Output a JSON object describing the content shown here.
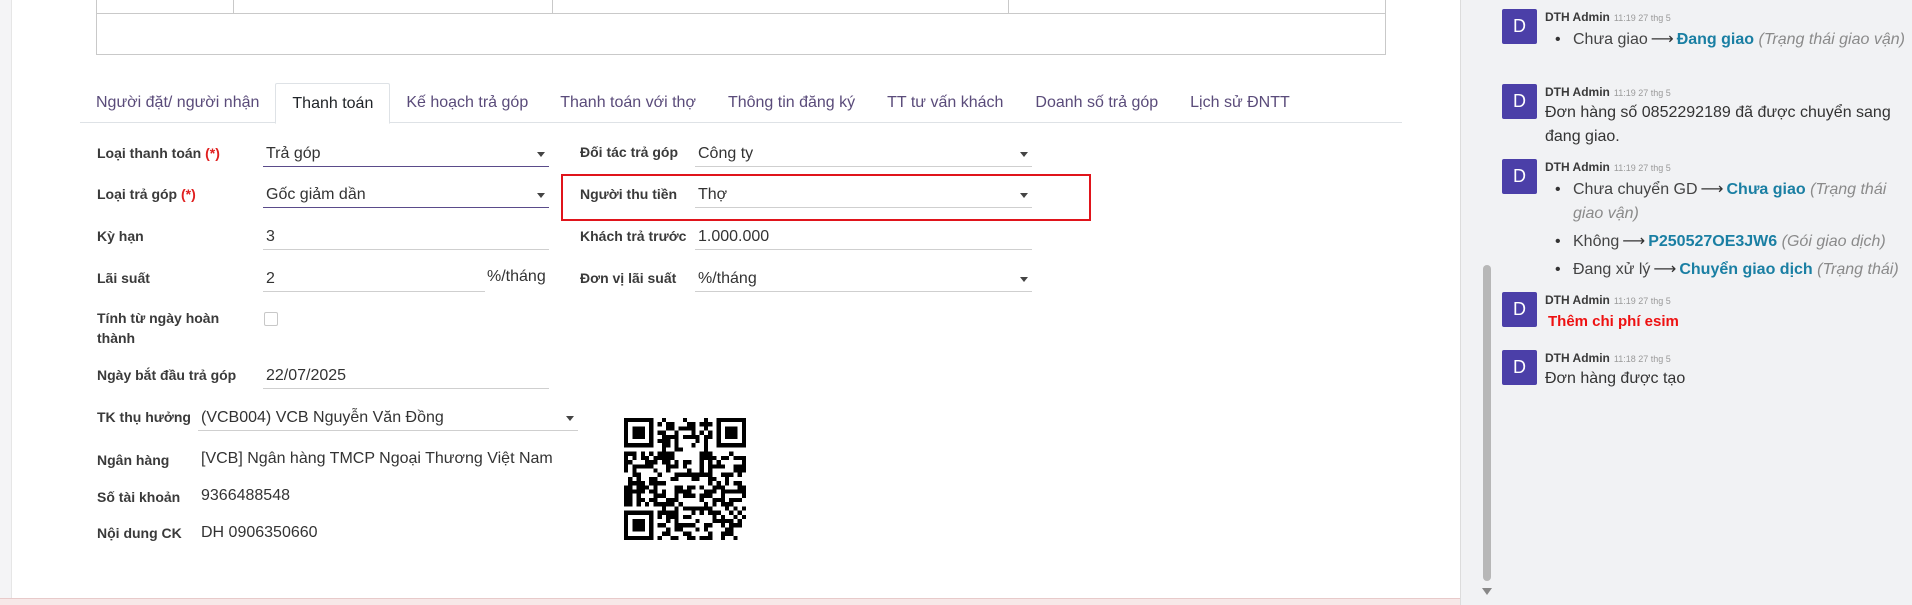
{
  "tabs": [
    {
      "label": "Người đặt/ người nhận",
      "active": false
    },
    {
      "label": "Thanh toán",
      "active": true
    },
    {
      "label": "Kế hoạch trả góp",
      "active": false
    },
    {
      "label": "Thanh toán với thợ",
      "active": false
    },
    {
      "label": "Thông tin đăng ký",
      "active": false
    },
    {
      "label": "TT tư vấn khách",
      "active": false
    },
    {
      "label": "Doanh số trả góp",
      "active": false
    },
    {
      "label": "Lịch sử ĐNTT",
      "active": false
    }
  ],
  "form": {
    "loai_thanh_toan": {
      "label": "Loại thanh toán",
      "required": "(*)",
      "value": "Trả góp"
    },
    "loai_tra_gop": {
      "label": "Loại trả góp",
      "required": "(*)",
      "value": "Gốc giảm dần"
    },
    "ky_han": {
      "label": "Kỳ hạn",
      "value": "3"
    },
    "lai_suat": {
      "label": "Lãi suất",
      "value": "2",
      "unit": "%/tháng"
    },
    "tinh_tu_ngay": {
      "label": "Tính từ ngày hoàn thành",
      "checked": false
    },
    "ngay_bat_dau": {
      "label": "Ngày bắt đầu trả góp",
      "value": "22/07/2025"
    },
    "doi_tac": {
      "label": "Đối tác trả góp",
      "value": "Công ty"
    },
    "nguoi_thu_tien": {
      "label": "Người thu tiền",
      "value": "Thợ"
    },
    "khach_tra_truoc": {
      "label": "Khách trả trước",
      "value": "1.000.000"
    },
    "don_vi_lai_suat": {
      "label": "Đơn vị lãi suất",
      "value": "%/tháng"
    },
    "tk_thu_huong": {
      "label": "TK thụ hưởng",
      "value": "(VCB004) VCB Nguyễn Văn Đồng"
    },
    "ngan_hang": {
      "label": "Ngân hàng",
      "value": "[VCB] Ngân hàng TMCP Ngoại Thương Việt Nam"
    },
    "so_tai_khoan": {
      "label": "Số tài khoản",
      "value": "9366488548"
    },
    "noi_dung_ck": {
      "label": "Nội dung CK",
      "value": "DH 0906350660"
    }
  },
  "chatter": [
    {
      "avatar": "D",
      "author": "DTH Admin",
      "time": "11:19 27 thg 5",
      "tracking": [
        {
          "old": "Chưa giao",
          "new": "Đang giao",
          "field": "(Trạng thái giao vận)"
        }
      ]
    },
    {
      "avatar": "D",
      "author": "DTH Admin",
      "time": "11:19 27 thg 5",
      "text": "Đơn hàng số 0852292189 đã được chuyển sang đang giao."
    },
    {
      "avatar": "D",
      "author": "DTH Admin",
      "time": "11:19 27 thg 5",
      "tracking": [
        {
          "old": "Chưa chuyển GD",
          "new": "Chưa giao",
          "field": "(Trạng thái giao vận)"
        },
        {
          "old": "Không",
          "new": "P250527OE3JW6",
          "field": "(Gói giao dịch)"
        },
        {
          "old": "Đang xử lý",
          "new": "Chuyển giao dịch",
          "field": "(Trạng thái)"
        }
      ]
    },
    {
      "avatar": "D",
      "author": "DTH Admin",
      "time": "11:19 27 thg 5",
      "text_red": "Thêm chi phí esim"
    },
    {
      "avatar": "D",
      "author": "DTH Admin",
      "time": "11:18 27 thg 5",
      "text": "Đơn hàng được tạo"
    }
  ]
}
